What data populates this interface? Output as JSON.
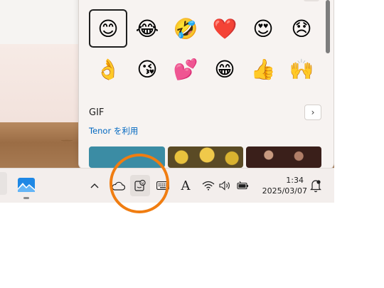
{
  "emoji_panel": {
    "emojis": [
      {
        "glyph": "😊",
        "name": "smiling-face"
      },
      {
        "glyph": "😂",
        "name": "face-with-tears-of-joy"
      },
      {
        "glyph": "🤣",
        "name": "rolling-on-floor-laughing"
      },
      {
        "glyph": "❤️",
        "name": "red-heart"
      },
      {
        "glyph": "😍",
        "name": "heart-eyes"
      },
      {
        "glyph": "😞",
        "name": "disappointed-face"
      },
      {
        "glyph": "👌",
        "name": "ok-hand"
      },
      {
        "glyph": "😘",
        "name": "face-blowing-kiss"
      },
      {
        "glyph": "💕",
        "name": "two-hearts"
      },
      {
        "glyph": "😁",
        "name": "beaming-face"
      },
      {
        "glyph": "👍",
        "name": "thumbs-up"
      },
      {
        "glyph": "🙌",
        "name": "raising-hands"
      }
    ],
    "selected_index": 0,
    "gif_label": "GIF",
    "gif_arrow": "›",
    "tenor_link": "Tenor を利用"
  },
  "taskbar": {
    "tray": {
      "chevron": "^",
      "ime_label": "A"
    },
    "clock": {
      "time": "1:34",
      "date": "2025/03/07"
    }
  },
  "colors": {
    "highlight_ring": "#f07d11",
    "link": "#0067c0",
    "taskbar_bg": "#f3eeec"
  }
}
